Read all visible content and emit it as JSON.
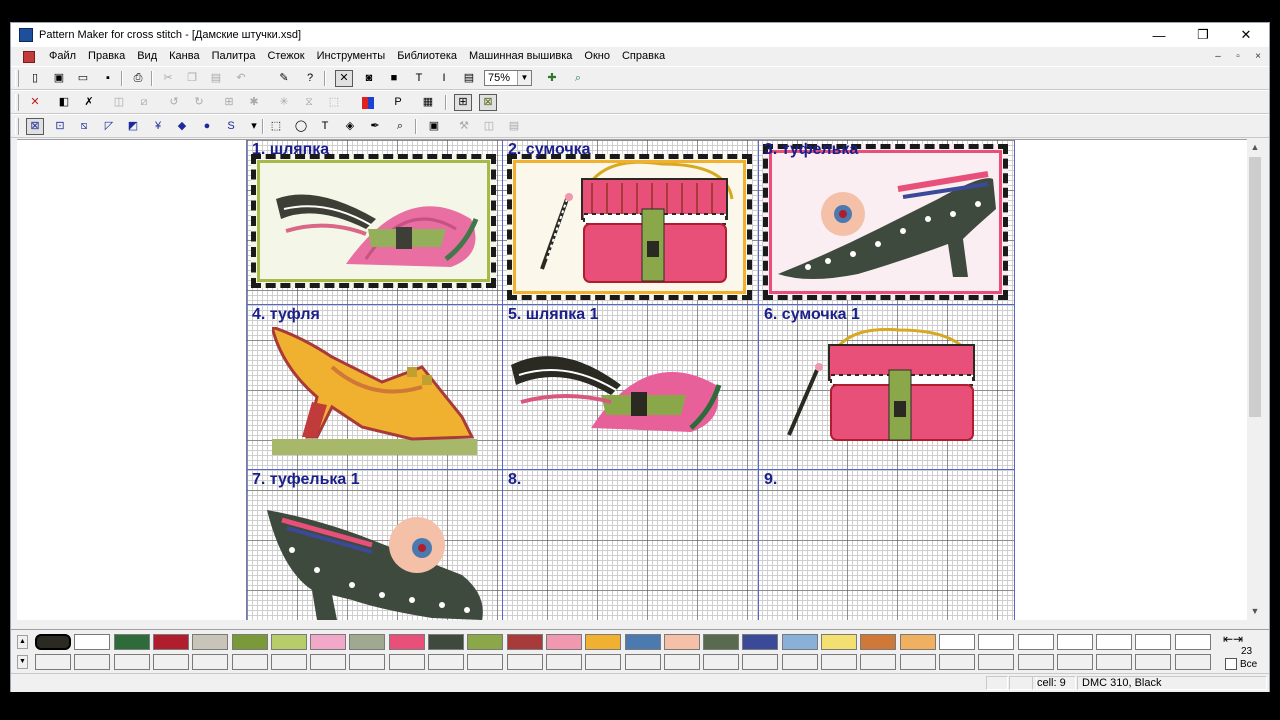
{
  "window": {
    "title": "Pattern Maker for cross stitch - [Дамские штучки.xsd]",
    "controls": {
      "minimize": "—",
      "restore": "❐",
      "close": "✕"
    }
  },
  "menu": {
    "items": [
      "Файл",
      "Правка",
      "Вид",
      "Канва",
      "Палитра",
      "Стежок",
      "Инструменты",
      "Библиотека",
      "Машинная вышивка",
      "Окно",
      "Справка"
    ],
    "mdi_controls": {
      "minimize": "–",
      "restore": "▫",
      "close": "×"
    }
  },
  "toolbar": {
    "zoom_value": "75%"
  },
  "cells": [
    {
      "label": "1.  шляпка"
    },
    {
      "label": "2.  сумочка"
    },
    {
      "label": "3.  туфелька"
    },
    {
      "label": "4.  туфля"
    },
    {
      "label": "5.  шляпка 1"
    },
    {
      "label": "6.  сумочка 1"
    },
    {
      "label": "7.  туфелька 1"
    },
    {
      "label": "8."
    },
    {
      "label": "9."
    }
  ],
  "palette": {
    "row1": [
      "#2a2a22",
      "#ffffff",
      "#2e6b3a",
      "#b01e2d",
      "#c8c4b8",
      "#7a9a3a",
      "#b8cc6a",
      "#f2a8c8",
      "#a0a890",
      "#e8507a",
      "#3e4a3e",
      "#8aa84a",
      "#a83a3a",
      "#f098b0",
      "#f0b030",
      "#4a7ab0",
      "#f4c0a8",
      "#5a6a50",
      "#3a4a98",
      "#88b0d8",
      "#f4e070",
      "#d07838",
      "#f0b060",
      "#ffffff",
      "#ffffff",
      "#ffffff",
      "#ffffff",
      "#ffffff",
      "#ffffff",
      "#ffffff"
    ],
    "row2_count": 30,
    "right_number": "23",
    "right_label": "Все"
  },
  "statusbar": {
    "cell": "cell: 9",
    "thread": "DMC  310, Black"
  }
}
